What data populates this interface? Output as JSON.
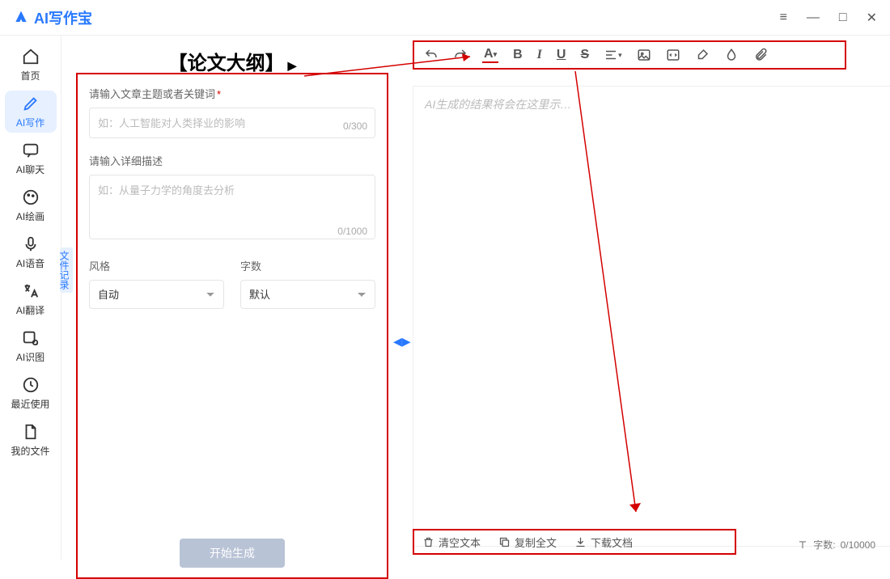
{
  "app": {
    "name": "AI写作宝"
  },
  "window": {
    "controls": {
      "menu": "≡",
      "min": "—",
      "max": "□",
      "close": "✕"
    }
  },
  "sidebar": {
    "items": [
      {
        "label": "首页"
      },
      {
        "label": "AI写作"
      },
      {
        "label": "AI聊天"
      },
      {
        "label": "AI绘画"
      },
      {
        "label": "AI语音"
      },
      {
        "label": "AI翻译"
      },
      {
        "label": "AI识图"
      },
      {
        "label": "最近使用"
      },
      {
        "label": "我的文件"
      }
    ]
  },
  "page": {
    "title": "【论文大纲】",
    "title_indicator": "▶"
  },
  "form": {
    "topic_label": "请输入文章主题或者关键词",
    "topic_placeholder": "如：人工智能对人类择业的影响",
    "topic_counter": "0/300",
    "desc_label": "请输入详细描述",
    "desc_placeholder": "如：从量子力学的角度去分析",
    "desc_counter": "0/1000",
    "style_label": "风格",
    "style_value": "自动",
    "count_label": "字数",
    "count_value": "默认",
    "generate_label": "开始生成",
    "side_tab": "文件记录"
  },
  "toolbar": {
    "items": [
      "undo",
      "redo",
      "font",
      "bold",
      "italic",
      "underline",
      "strike",
      "align",
      "image",
      "code",
      "brush",
      "droplet",
      "attach"
    ]
  },
  "editor": {
    "placeholder": "AI生成的结果将会在这里示…"
  },
  "footer": {
    "clear": "清空文本",
    "copy": "复制全文",
    "download": "下载文档",
    "wc_label": "字数:",
    "wc_value": "0/10000"
  },
  "colors": {
    "accent": "#2979ff",
    "annotate": "#d40000"
  }
}
